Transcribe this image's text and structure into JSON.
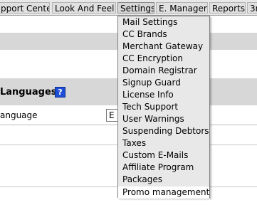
{
  "menubar": {
    "items": [
      {
        "label": "pport Center"
      },
      {
        "label": "Look And Feel"
      },
      {
        "label": "Settings"
      },
      {
        "label": "E. Manager"
      },
      {
        "label": "Reports"
      },
      {
        "label": "3r"
      }
    ]
  },
  "settings_menu": {
    "items": [
      {
        "label": "Mail Settings"
      },
      {
        "label": "CC Brands"
      },
      {
        "label": "Merchant Gateway"
      },
      {
        "label": "CC Encryption"
      },
      {
        "label": "Domain Registrar"
      },
      {
        "label": "Signup Guard"
      },
      {
        "label": "License Info"
      },
      {
        "label": "Tech Support"
      },
      {
        "label": "User Warnings"
      },
      {
        "label": "Suspending Debtors"
      },
      {
        "label": "Taxes"
      },
      {
        "label": "Custom E-Mails"
      },
      {
        "label": "Affiliate Program"
      },
      {
        "label": "Packages"
      },
      {
        "label": "Promo management"
      }
    ]
  },
  "languages_section": {
    "title": "Languages",
    "help_icon": "?",
    "row_label": "anguage",
    "select_value": "E"
  }
}
